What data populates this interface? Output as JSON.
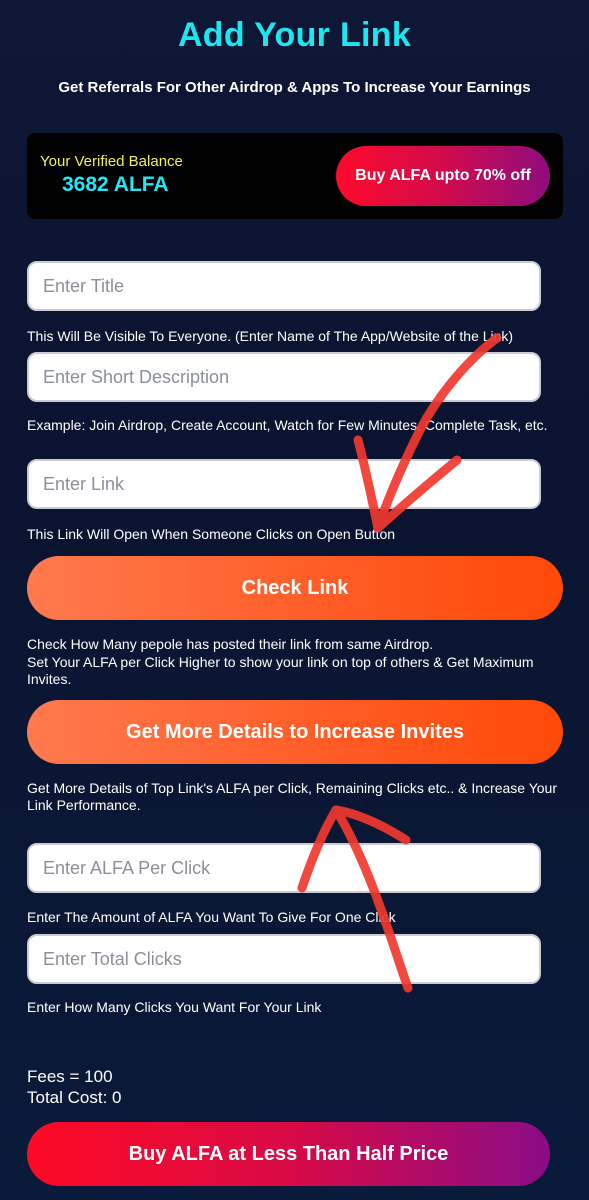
{
  "header": {
    "title": "Add Your Link",
    "subtitle": "Get Referrals For Other Airdrop & Apps To Increase Your Earnings"
  },
  "balance": {
    "label": "Your Verified Balance",
    "value": "3682 ALFA",
    "buy_button": "Buy ALFA upto 70% off"
  },
  "form": {
    "title_placeholder": "Enter Title",
    "title_hint": "This Will Be Visible To Everyone. (Enter Name of The App/Website of the Link)",
    "description_placeholder": "Enter Short Description",
    "description_hint": "Example: Join Airdrop, Create Account, Watch for Few Minutes, Complete Task, etc.",
    "link_placeholder": "Enter Link",
    "link_hint": "This Link Will Open When Someone Clicks on Open Button",
    "check_link_button": "Check Link",
    "check_link_hint_1": "Check How Many pepole has posted their link from same Airdrop.",
    "check_link_hint_2": "Set Your ALFA per Click Higher to show your link on top of others & Get Maximum Invites.",
    "details_button": "Get More Details to Increase Invites",
    "details_hint": "Get More Details of Top Link's ALFA per Click, Remaining Clicks etc.. & Increase Your Link Performance.",
    "per_click_placeholder": "Enter ALFA Per Click",
    "per_click_hint": "Enter The Amount of ALFA You Want To Give For One Click",
    "total_clicks_placeholder": "Enter Total Clicks",
    "total_clicks_hint": "Enter How Many Clicks You Want For Your Link"
  },
  "summary": {
    "fees": "Fees = 100",
    "total_cost": "Total Cost: 0"
  },
  "footer": {
    "buy_button": "Buy ALFA at Less Than Half Price"
  },
  "colors": {
    "accent_cyan": "#1ee6f0",
    "balance_label": "#f3f14c",
    "orange_button": "#ff5a23",
    "annotation_red": "#f0392f"
  }
}
